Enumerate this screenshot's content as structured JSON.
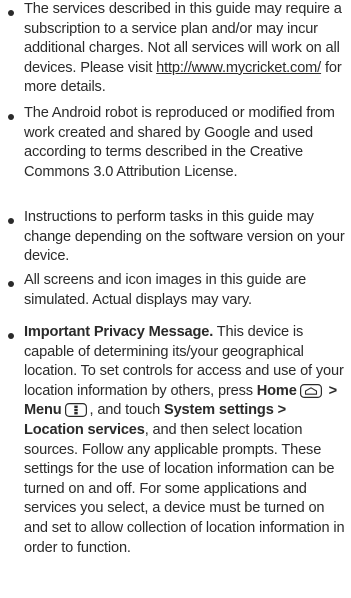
{
  "items": [
    {
      "text_before_link": "The services described in this guide may require a subscription to a service plan and/or may incur additional charges. Not all services will work on all devices. Please visit ",
      "link": "http://www.mycricket.com/",
      "text_after_link": " for more details."
    },
    {
      "text": "The Android robot is reproduced or modified from work created and shared by Google and used according to terms described in the Creative Commons 3.0 Attribution License."
    },
    {
      "text": "Instructions to perform tasks in this guide may change depending on the software version on your device."
    },
    {
      "text": "All screens and icon images in this guide are simulated. Actual displays may vary."
    },
    {
      "heading": "Important Privacy Message.",
      "intro": " This device is capable of determining its/your geographical location. To set controls for access and use of your location information by others, press ",
      "home_label": "Home",
      "separator": " > ",
      "menu_label": "Menu",
      "mid_text": ", and touch ",
      "path_label": "System settings > Location services",
      "outro": ", and then select location sources. Follow any applicable prompts. These settings for the use of location information can be turned on and off. For some applications and services you select, a device must be turned on and set to allow collection of location information in order to function.",
      "home_icon": "home-key-icon",
      "menu_icon": "menu-key-icon"
    }
  ]
}
